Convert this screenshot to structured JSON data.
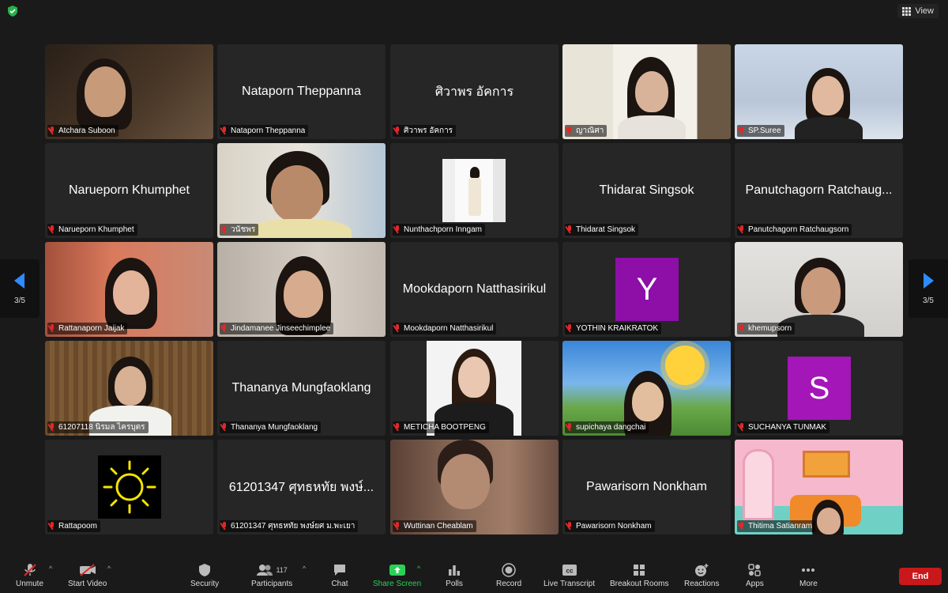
{
  "header": {
    "view_label": "View"
  },
  "navigation": {
    "page_left": "3/5",
    "page_right": "3/5"
  },
  "participants_grid": [
    {
      "name": "Atchara Suboon",
      "display": "",
      "video": true
    },
    {
      "name": "Nataporn Theppanna",
      "display": "Nataporn Theppanna",
      "video": false
    },
    {
      "name": "ศิวาพร อัคการ",
      "display": "ศิวาพร อัคการ",
      "video": false
    },
    {
      "name": "ญาณิศา",
      "display": "",
      "video": true
    },
    {
      "name": "SP.Suree",
      "display": "",
      "video": true
    },
    {
      "name": "Narueporn Khumphet",
      "display": "Narueporn Khumphet",
      "video": false
    },
    {
      "name": "วนัชพร",
      "display": "",
      "video": true
    },
    {
      "name": "Nunthachporn Inngam",
      "display": "",
      "video": true
    },
    {
      "name": "Thidarat Singsok",
      "display": "Thidarat Singsok",
      "video": false
    },
    {
      "name": "Panutchagorn Ratchaugsorn",
      "display": "Panutchagorn Ratchaug...",
      "video": false
    },
    {
      "name": "Rattanaporn Jaijak",
      "display": "",
      "video": true
    },
    {
      "name": "Jindamanee Jinseechimplee",
      "display": "",
      "video": true
    },
    {
      "name": "Mookdaporn Natthasirikul",
      "display": "Mookdaporn Natthasirikul",
      "video": false
    },
    {
      "name": "YOTHIN KRAIKRATOK",
      "display": "",
      "video": false,
      "avatar_letter": "Y",
      "avatar_color": "#8e0ea8"
    },
    {
      "name": "khemupsorn",
      "display": "",
      "video": true
    },
    {
      "name": "61207118 นิรมล ไครบุตร",
      "display": "",
      "video": true
    },
    {
      "name": "Thananya Mungfaoklang",
      "display": "Thananya Mungfaoklang",
      "video": false
    },
    {
      "name": "METICHA BOOTPENG",
      "display": "",
      "video": true
    },
    {
      "name": "supichaya dangchai",
      "display": "",
      "video": true
    },
    {
      "name": "SUCHANYA TUNMAK",
      "display": "",
      "video": false,
      "avatar_letter": "S",
      "avatar_color": "#a416b8"
    },
    {
      "name": "Rattapoom",
      "display": "",
      "video": true
    },
    {
      "name": "61201347 ศุทธหทัย พงษ์ยศ ม.พะเยา",
      "display": "61201347 ศุทธหทัย พงษ์...",
      "video": false
    },
    {
      "name": "Wuttinan Cheablam",
      "display": "",
      "video": true
    },
    {
      "name": "Pawarisorn Nonkham",
      "display": "Pawarisorn Nonkham",
      "video": false
    },
    {
      "name": "Thitima Satianram",
      "display": "",
      "video": true
    }
  ],
  "toolbar": {
    "unmute": "Unmute",
    "start_video": "Start Video",
    "security": "Security",
    "participants": "Participants",
    "participants_count": "117",
    "chat": "Chat",
    "share_screen": "Share Screen",
    "polls": "Polls",
    "record": "Record",
    "live_transcript": "Live Transcript",
    "breakout_rooms": "Breakout Rooms",
    "reactions": "Reactions",
    "apps": "Apps",
    "more": "More",
    "end": "End"
  },
  "colors": {
    "end_button": "#c8181b",
    "share_green": "#2bd155",
    "nav_arrow": "#2d8cff",
    "muted_red": "#e02828"
  }
}
